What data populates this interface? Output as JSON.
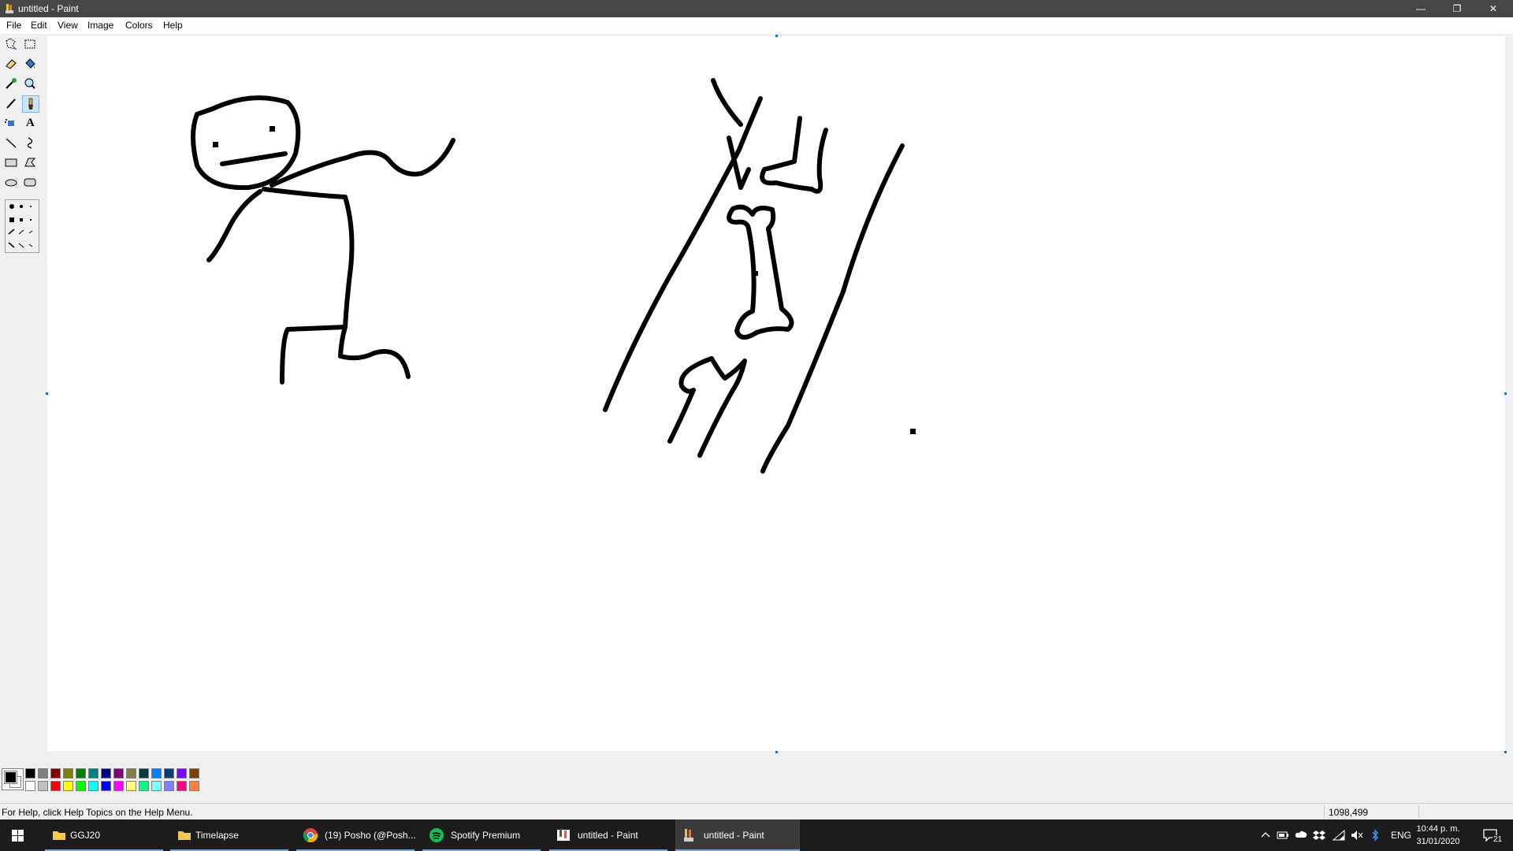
{
  "window": {
    "title": "untitled - Paint",
    "minimize_glyph": "—",
    "restore_glyph": "❐",
    "close_glyph": "✕"
  },
  "menu": [
    "File",
    "Edit",
    "View",
    "Image",
    "Colors",
    "Help"
  ],
  "tools": [
    {
      "name": "free-form-select-icon"
    },
    {
      "name": "select-icon"
    },
    {
      "name": "eraser-icon"
    },
    {
      "name": "fill-with-color-icon"
    },
    {
      "name": "pick-color-icon"
    },
    {
      "name": "magnifier-icon"
    },
    {
      "name": "pencil-icon"
    },
    {
      "name": "brush-icon",
      "selected": true
    },
    {
      "name": "airbrush-icon"
    },
    {
      "name": "text-icon",
      "glyph": "A"
    },
    {
      "name": "line-icon"
    },
    {
      "name": "curve-icon"
    },
    {
      "name": "rectangle-icon"
    },
    {
      "name": "polygon-icon"
    },
    {
      "name": "ellipse-icon"
    },
    {
      "name": "rounded-rectangle-icon"
    }
  ],
  "palette": {
    "foreground": "#000000",
    "background": "#ffffff",
    "top_row": [
      "#000000",
      "#808080",
      "#800000",
      "#808000",
      "#008000",
      "#008080",
      "#000080",
      "#800080",
      "#808040",
      "#004040",
      "#0080ff",
      "#004080",
      "#8000ff",
      "#804000"
    ],
    "bottom_row": [
      "#ffffff",
      "#c0c0c0",
      "#ff0000",
      "#ffff00",
      "#00ff00",
      "#00ffff",
      "#0000ff",
      "#ff00ff",
      "#ffff80",
      "#00ff80",
      "#80ffff",
      "#8080ff",
      "#ff0080",
      "#ff8040"
    ]
  },
  "status": {
    "help_text": "For Help, click Help Topics on the Help Menu.",
    "coordinates": "1098,499"
  },
  "taskbar": {
    "items": [
      {
        "label": "GGJ20",
        "icon": "folder-icon"
      },
      {
        "label": "Timelapse",
        "icon": "folder-icon"
      },
      {
        "label": "(19) Posho (@Posh...",
        "icon": "chrome-icon"
      },
      {
        "label": "Spotify Premium",
        "icon": "spotify-icon"
      },
      {
        "label": "untitled - Paint",
        "icon": "paint-icon"
      },
      {
        "label": "untitled - Paint",
        "icon": "paint-icon",
        "active": true
      }
    ],
    "language": "ENG",
    "time": "10:44 p. m.",
    "date": "31/01/2020",
    "notification_count": "21"
  }
}
